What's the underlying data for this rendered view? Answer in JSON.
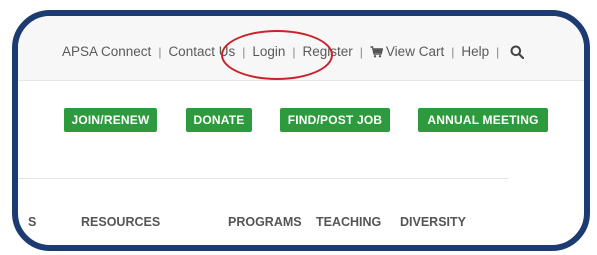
{
  "utility": {
    "apsa_connect": "APSA Connect",
    "contact_us": "Contact Us",
    "login": "Login",
    "register": "Register",
    "view_cart": "View Cart",
    "help": "Help",
    "separator": "|"
  },
  "cta": {
    "join": "JOIN/RENEW",
    "donate": "DONATE",
    "find_job": "FIND/POST JOB",
    "annual_meeting": "ANNUAL MEETING"
  },
  "nav": {
    "partial": "S",
    "resources": "RESOURCES",
    "programs": "PROGRAMS",
    "teaching": "TEACHING",
    "diversity": "DIVERSITY"
  },
  "colors": {
    "frame": "#1c3b72",
    "button": "#2e9a3e",
    "highlight": "#c8232c"
  },
  "icons": [
    "shopping-cart-icon",
    "search-icon"
  ]
}
